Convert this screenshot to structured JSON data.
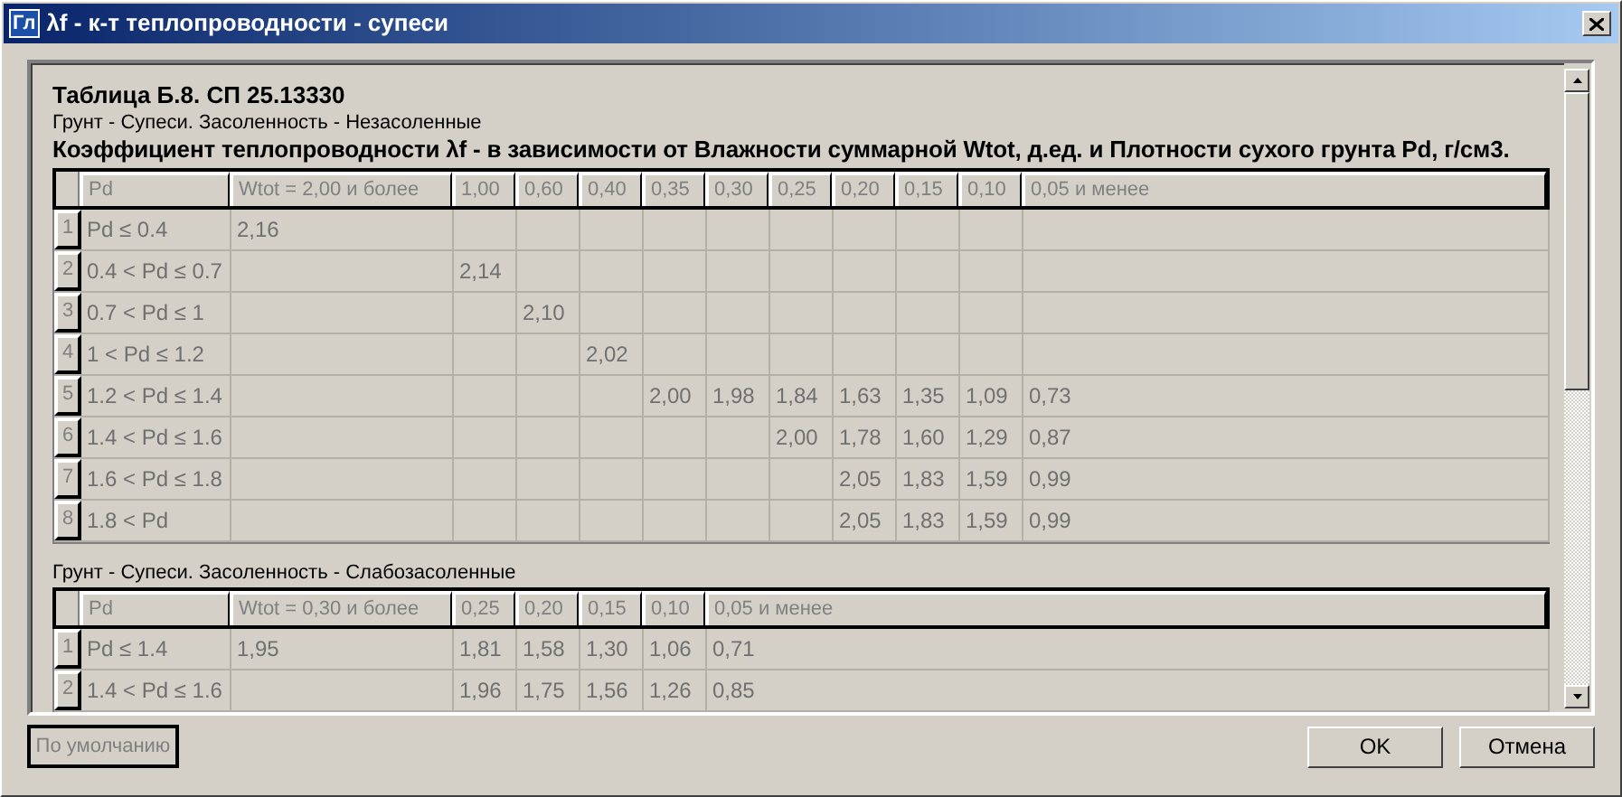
{
  "window": {
    "icon_text": "Гл",
    "title": "λf - к-т теплопроводности - супеси"
  },
  "table_title": "Таблица Б.8. СП 25.13330",
  "sections": [
    {
      "subtitle": "Грунт - Супеси. Засоленность - Незасоленные",
      "heading": "Коэффициент теплопроводности λf - в зависимости от Влажности суммарной Wtot, д.ед. и Плотности сухого грунта Pd, г/см3.",
      "columns": [
        "Pd",
        "Wtot = 2,00 и более",
        "1,00",
        "0,60",
        "0,40",
        "0,35",
        "0,30",
        "0,25",
        "0,20",
        "0,15",
        "0,10",
        "0,05 и менее"
      ],
      "rows": [
        {
          "number": "1",
          "cells": [
            "Pd ≤ 0.4",
            "2,16",
            null,
            null,
            null,
            null,
            null,
            null,
            null,
            null,
            null,
            null
          ]
        },
        {
          "number": "2",
          "cells": [
            "0.4 < Pd ≤ 0.7",
            null,
            "2,14",
            null,
            null,
            null,
            null,
            null,
            null,
            null,
            null,
            null
          ]
        },
        {
          "number": "3",
          "cells": [
            "0.7 < Pd ≤ 1",
            null,
            null,
            "2,10",
            null,
            null,
            null,
            null,
            null,
            null,
            null,
            null
          ]
        },
        {
          "number": "4",
          "cells": [
            "1 < Pd ≤ 1.2",
            null,
            null,
            null,
            "2,02",
            null,
            null,
            null,
            null,
            null,
            null,
            null
          ]
        },
        {
          "number": "5",
          "cells": [
            "1.2 < Pd ≤ 1.4",
            null,
            null,
            null,
            null,
            "2,00",
            "1,98",
            "1,84",
            "1,63",
            "1,35",
            "1,09",
            "0,73"
          ]
        },
        {
          "number": "6",
          "cells": [
            "1.4 < Pd ≤ 1.6",
            null,
            null,
            null,
            null,
            null,
            null,
            "2,00",
            "1,78",
            "1,60",
            "1,29",
            "0,87"
          ]
        },
        {
          "number": "7",
          "cells": [
            "1.6 < Pd ≤ 1.8",
            null,
            null,
            null,
            null,
            null,
            null,
            null,
            "2,05",
            "1,83",
            "1,59",
            "0,99"
          ]
        },
        {
          "number": "8",
          "cells": [
            "1.8 < Pd",
            null,
            null,
            null,
            null,
            null,
            null,
            null,
            "2,05",
            "1,83",
            "1,59",
            "0,99"
          ]
        }
      ]
    },
    {
      "subtitle": "Грунт - Супеси. Засоленность - Слабозасоленные",
      "columns": [
        "Pd",
        "Wtot = 0,30 и более",
        "0,25",
        "0,20",
        "0,15",
        "0,10",
        "0,05 и менее"
      ],
      "rows": [
        {
          "number": "1",
          "cells": [
            "Pd ≤ 1.4",
            "1,95",
            "1,81",
            "1,58",
            "1,30",
            "1,06",
            "0,71"
          ]
        },
        {
          "number": "2",
          "cells": [
            "1.4 < Pd ≤ 1.6",
            null,
            "1,96",
            "1,75",
            "1,56",
            "1,26",
            "0,85"
          ]
        }
      ]
    }
  ],
  "buttons": [
    {
      "kind": "default",
      "label": "По умолчанию"
    },
    {
      "kind": "ok",
      "label": "OK"
    },
    {
      "kind": "cancel",
      "label": "Отмена"
    }
  ]
}
